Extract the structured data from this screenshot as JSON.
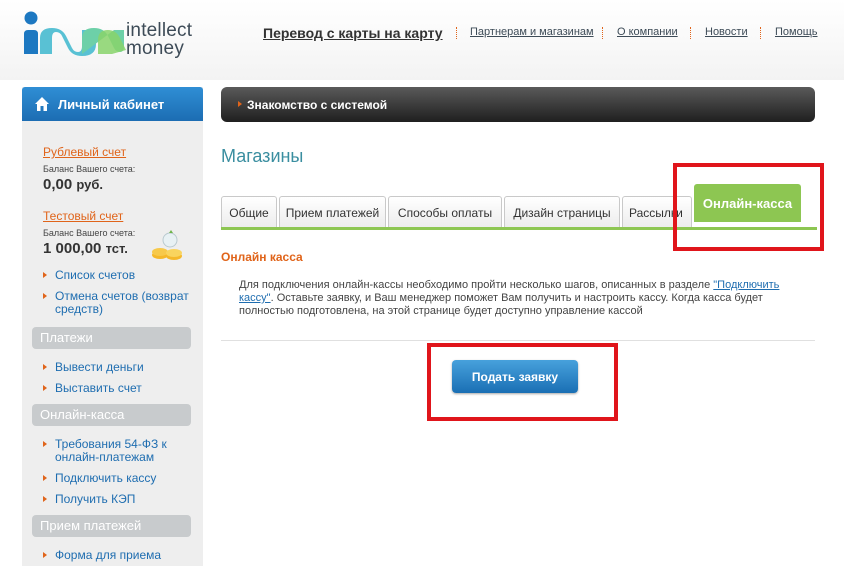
{
  "brand": {
    "line1": "intellect",
    "line2": "money"
  },
  "nav": {
    "main": "Перевод с карты на карту",
    "items": [
      "Партнерам и магазинам",
      "О компании",
      "Новости",
      "Помощь"
    ]
  },
  "sidebar": {
    "cabinet_title": "Личный кабинет",
    "accounts": [
      {
        "name": "Рублевый счет",
        "balance_label": "Баланс Вашего счета:",
        "amount": "0,00",
        "currency": "руб."
      },
      {
        "name": "Тестовый счет",
        "balance_label": "Баланс Вашего счета:",
        "amount": "1 000,00",
        "currency": "тст."
      }
    ],
    "account_links": [
      "Список счетов",
      "Отмена счетов (возврат средств)"
    ],
    "sections": [
      {
        "title": "Платежи",
        "items": [
          "Вывести деньги",
          "Выставить счет"
        ]
      },
      {
        "title": "Онлайн-касса",
        "items": [
          "Требования 54-ФЗ к онлайн-платежам",
          "Подключить кассу",
          "Получить КЭП"
        ]
      },
      {
        "title": "Прием платежей",
        "items": [
          "Форма для приема"
        ]
      }
    ]
  },
  "main": {
    "panel_title": "Знакомство с системой",
    "page_title": "Магазины",
    "tabs": [
      "Общие",
      "Прием платежей",
      "Способы оплаты",
      "Дизайн страницы",
      "Рассылки",
      "Онлайн-касса"
    ],
    "active_tab": "Онлайн-касса",
    "section_title": "Онлайн касса",
    "desc_before": "Для подключения онлайн-кассы необходимо пройти несколько шагов, описанных в разделе ",
    "desc_link": "\"Подключить кассу\"",
    "desc_after": ". Оставьте заявку, и Ваш менеджер поможет Вам получить и настроить кассу. Когда касса будет полностью подготовлена, на этой странице будет доступно управление кассой",
    "apply_button": "Подать заявку"
  },
  "colors": {
    "accent_orange": "#e0641a",
    "link_blue": "#1e6db0",
    "tab_green": "#8dc652",
    "highlight_red": "#e0151b"
  }
}
